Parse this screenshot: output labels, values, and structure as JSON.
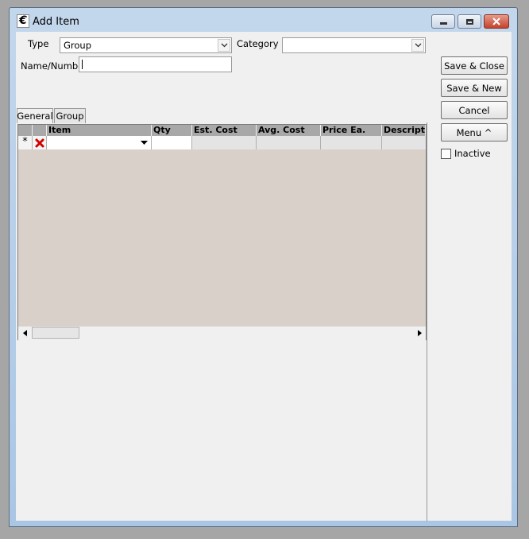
{
  "window": {
    "title": "Add Item"
  },
  "form": {
    "type_label": "Type",
    "type_value": "Group",
    "category_label": "Category",
    "category_value": "",
    "name_label": "Name/Number",
    "name_value": ""
  },
  "buttons": {
    "save_close": "Save & Close",
    "save_new": "Save & New",
    "cancel": "Cancel",
    "menu": "Menu ^"
  },
  "inactive": {
    "label": "Inactive",
    "checked": false
  },
  "tabs": [
    {
      "label": "General",
      "active": true
    },
    {
      "label": "Group",
      "active": false
    }
  ],
  "grid": {
    "columns": [
      "Item",
      "Qty",
      "Est. Cost",
      "Avg. Cost",
      "Price Ea.",
      "Descriptio"
    ],
    "new_row": {
      "marker": "*"
    }
  }
}
